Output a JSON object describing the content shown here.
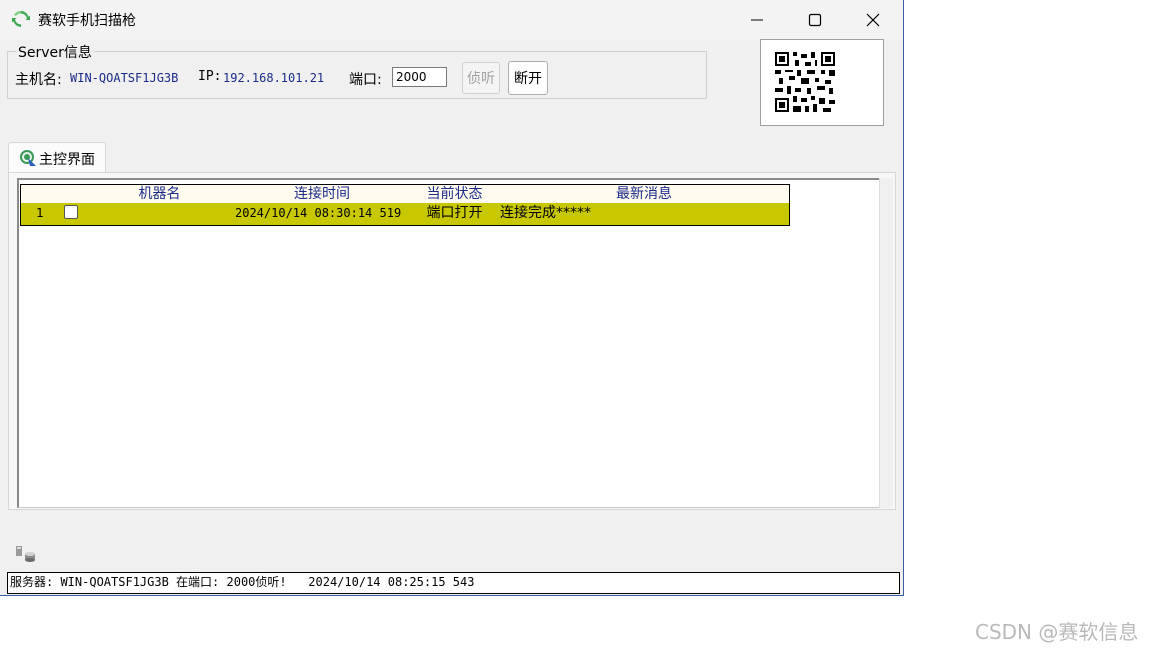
{
  "window": {
    "title": "赛软手机扫描枪"
  },
  "server": {
    "group_label": "Server信息",
    "hostname_label": "主机名:",
    "hostname_value": "WIN-QOATSF1JG3B",
    "ip_label": "IP:",
    "ip_value": "192.168.101.21",
    "port_label": "端口:",
    "port_value": "2000",
    "listen_label": "侦听",
    "disconnect_label": "断开"
  },
  "tabs": [
    {
      "label": "主控界面"
    }
  ],
  "grid": {
    "columns": [
      "",
      "",
      "机器名",
      "连接时间",
      "当前状态",
      "最新消息"
    ],
    "rows": [
      {
        "index": "1",
        "checked": false,
        "machine": "",
        "time": "2024/10/14 08:30:14 519",
        "state": "端口打开",
        "message": "连接完成*****"
      }
    ],
    "row_color": "#c8c800",
    "header_text_color": "#1a2b8a"
  },
  "statusbar": {
    "text": "服务器: WIN-QOATSF1JG3B 在端口: 2000侦听!   2024/10/14 08:25:15 543"
  },
  "watermark": "CSDN @赛软信息",
  "icons": [
    "refresh-icon",
    "minimize-icon",
    "maximize-icon",
    "close-icon",
    "qr-code-icon",
    "tab-globe-icon",
    "database-icon"
  ]
}
